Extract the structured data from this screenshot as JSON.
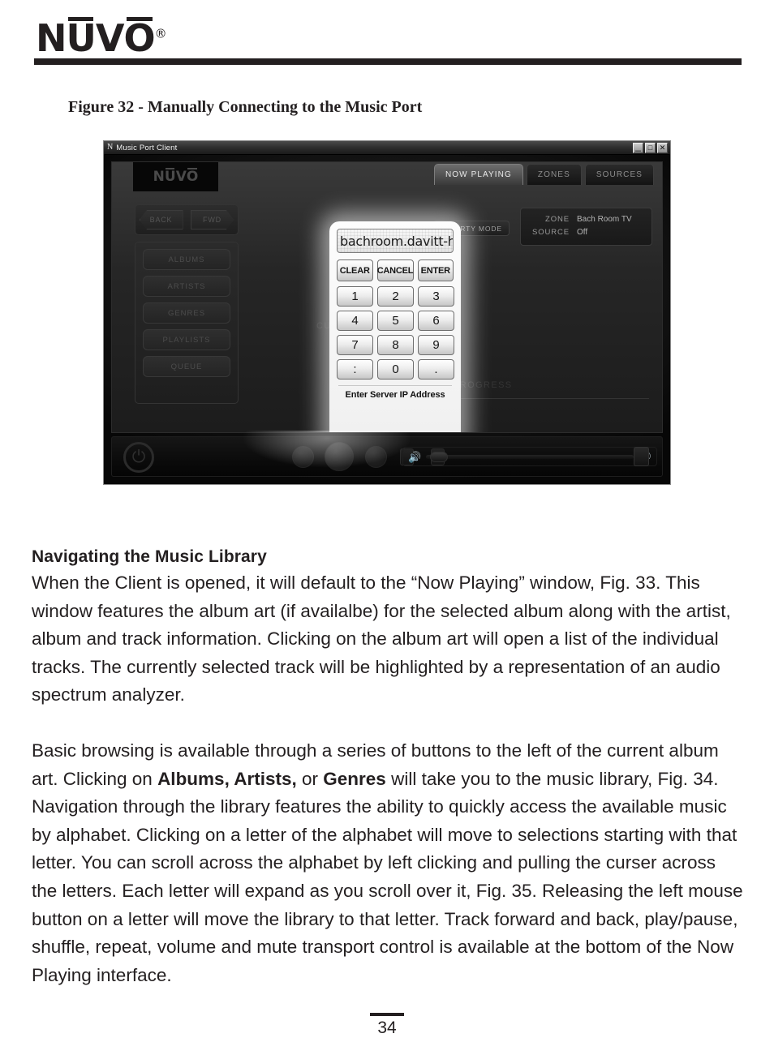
{
  "header": {
    "brand": "NUVO",
    "brand_registered": "®"
  },
  "figure": {
    "caption": "Figure 32 - Manually Connecting to the Music Port",
    "window": {
      "title": "Music Port Client",
      "title_icon": "N",
      "controls": {
        "minimize": "_",
        "maximize": "□",
        "close": "✕"
      }
    },
    "app": {
      "logo": "NUVO",
      "tabs": [
        {
          "label": "NOW PLAYING",
          "active": true
        },
        {
          "label": "ZONES",
          "active": false
        },
        {
          "label": "SOURCES",
          "active": false
        }
      ],
      "party_mode": {
        "label": "PARTY MODE",
        "icon": "☀"
      },
      "zone_panel": {
        "zone_key": "ZONE",
        "zone_value": "Bach Room TV",
        "source_key": "SOURCE",
        "source_value": "Off"
      },
      "nav_top": [
        {
          "label": "BACK"
        },
        {
          "label": "FWD"
        }
      ],
      "nav_items": [
        {
          "label": "ALBUMS"
        },
        {
          "label": "ARTISTS"
        },
        {
          "label": "GENRES"
        },
        {
          "label": "PLAYLISTS"
        },
        {
          "label": "QUEUE"
        }
      ],
      "background_labels": {
        "current": "CURRENT",
        "progress": "PROGRESS"
      },
      "transport": {
        "power": "⏻",
        "volume_low_icon": "🔊",
        "volume_high_icon": "🔊"
      }
    },
    "keypad": {
      "field_value": "bachroom.davitt-h",
      "actions": [
        {
          "label": "CLEAR"
        },
        {
          "label": "CANCEL"
        },
        {
          "label": "ENTER"
        }
      ],
      "keys": [
        "1",
        "2",
        "3",
        "4",
        "5",
        "6",
        "7",
        "8",
        "9",
        ":",
        "0",
        "."
      ],
      "caption": "Enter Server IP Address"
    }
  },
  "content": {
    "heading": "Navigating the Music Library",
    "paragraph1": "When the Client is opened, it will default to the “Now Playing” window, Fig. 33. This window features the album art (if availalbe) for the selected album along with the artist, album and track information. Clicking on the album art will open a list of the individual tracks. The currently selected track will be highlighted by a representation of an audio spectrum analyzer.",
    "paragraph2_part1": "Basic browsing is available through a series of buttons to the left of the current album art. Clicking on ",
    "paragraph2_bold1": "Albums, Artists,",
    "paragraph2_part2": " or ",
    "paragraph2_bold2": "Genres",
    "paragraph2_part3": " will take you to the music library, Fig. 34. Navigation through the library features the ability to quickly access the available music by alphabet. Clicking on a letter of the alphabet will move to selections starting with that letter. You can scroll across the alphabet by left clicking and pulling the curser across the letters. Each letter will expand as you scroll over it, Fig. 35. Releasing the left mouse button on a letter will move the library to that letter. Track forward and back, play/pause, shuffle, repeat, volume and mute transport control is available at the bottom of the Now Playing interface."
  },
  "footer": {
    "page_number": "34"
  }
}
